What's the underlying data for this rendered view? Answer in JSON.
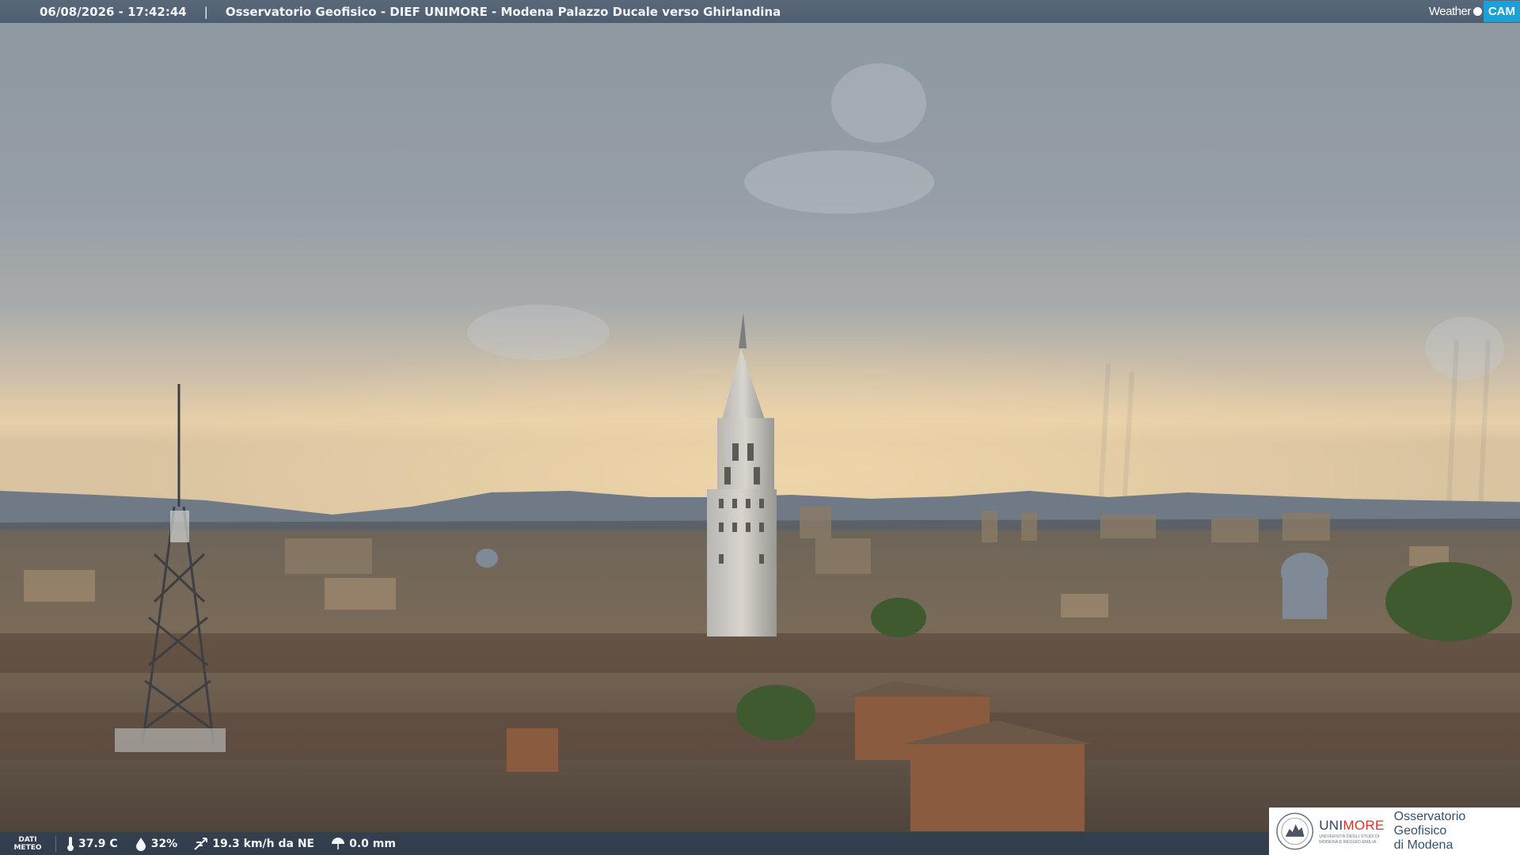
{
  "overlay_top": {
    "datetime": "06/08/2026 - 17:42:44",
    "separator": "|",
    "title": "Osservatorio Geofisico - DIEF UNIMORE - Modena Palazzo Ducale verso Ghirlandina"
  },
  "brand_logo": {
    "weather": "Weather",
    "cam": "CAM"
  },
  "overlay_bottom": {
    "label_line1": "DATI",
    "label_line2": "METEO",
    "temperature": "37.9 C",
    "humidity": "32%",
    "wind": "19.3 km/h da NE",
    "rain": "0.0 mm",
    "icons": [
      "thermometer-icon",
      "humidity-drop-icon",
      "wind-icon",
      "rain-umbrella-icon"
    ]
  },
  "institution_logo": {
    "name_part1": "UNI",
    "name_part2": "MORE",
    "subtitle_line1": "UNIVERSITÀ DEGLI STUDI DI",
    "subtitle_line2": "MODENA E REGGIO EMILIA",
    "observatory_line1": "Osservatorio Geofisico",
    "observatory_line2": "di Modena"
  },
  "colors": {
    "topbar": "#556577",
    "bottombar": "#1e3c5f",
    "cam_accent": "#1aa1d6",
    "unimore_red": "#d4322f",
    "unimore_blue": "#2c3e63"
  }
}
